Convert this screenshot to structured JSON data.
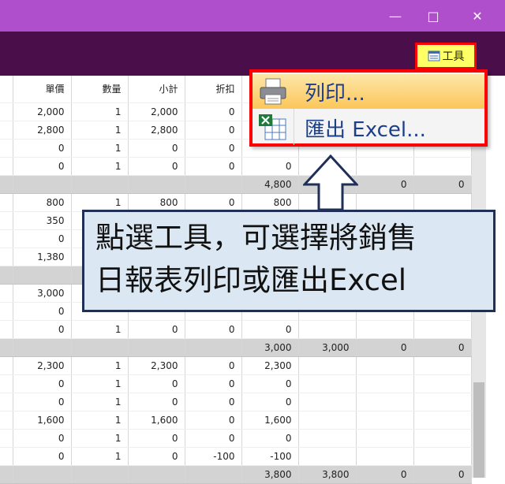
{
  "window": {
    "minimize": "—",
    "maximize": "□",
    "close": "✕"
  },
  "toolbar": {
    "tools_label": "工具",
    "tools_icon": "list-icon"
  },
  "table": {
    "headers": [
      "單價",
      "數量",
      "小計",
      "折扣",
      ""
    ],
    "rows": [
      {
        "c": [
          "2,000",
          "1",
          "2,000",
          "0",
          ""
        ]
      },
      {
        "c": [
          "2,800",
          "1",
          "2,800",
          "0",
          ""
        ]
      },
      {
        "c": [
          "0",
          "1",
          "0",
          "0",
          ""
        ]
      },
      {
        "c": [
          "0",
          "1",
          "0",
          "0",
          "0"
        ]
      },
      {
        "sub": true,
        "c": [
          "",
          "",
          "",
          "",
          "4,800",
          "",
          "0",
          "0"
        ]
      },
      {
        "c": [
          "800",
          "1",
          "800",
          "0",
          "800"
        ]
      },
      {
        "c": [
          "350",
          "",
          "",
          "",
          ""
        ]
      },
      {
        "c": [
          "0",
          "",
          "",
          "",
          ""
        ]
      },
      {
        "c": [
          "1,380",
          "",
          "",
          "",
          ""
        ]
      },
      {
        "sub": true,
        "c": [
          "",
          "",
          "",
          "",
          "",
          "",
          "",
          ""
        ]
      },
      {
        "c": [
          "3,000",
          "",
          "",
          "",
          ""
        ]
      },
      {
        "c": [
          "0",
          "",
          "",
          "",
          ""
        ]
      },
      {
        "c": [
          "0",
          "1",
          "0",
          "0",
          "0"
        ]
      },
      {
        "sub": true,
        "c": [
          "",
          "",
          "",
          "",
          "3,000",
          "3,000",
          "0",
          "0"
        ]
      },
      {
        "c": [
          "2,300",
          "1",
          "2,300",
          "0",
          "2,300"
        ]
      },
      {
        "c": [
          "0",
          "1",
          "0",
          "0",
          "0"
        ]
      },
      {
        "c": [
          "0",
          "1",
          "0",
          "0",
          "0"
        ]
      },
      {
        "c": [
          "1,600",
          "1",
          "1,600",
          "0",
          "1,600"
        ]
      },
      {
        "c": [
          "0",
          "1",
          "0",
          "0",
          "0"
        ]
      },
      {
        "c": [
          "0",
          "1",
          "0",
          "-100",
          "-100"
        ]
      },
      {
        "sub": true,
        "c": [
          "",
          "",
          "",
          "",
          "3,800",
          "3,800",
          "0",
          "0"
        ]
      }
    ]
  },
  "menu": {
    "print_label": "列印...",
    "print_icon": "printer-icon",
    "export_label": "匯出 Excel...",
    "export_icon": "excel-icon"
  },
  "callout": {
    "line1": "點選工具，可選擇將銷售",
    "line2": "日報表列印或匯出Excel"
  }
}
